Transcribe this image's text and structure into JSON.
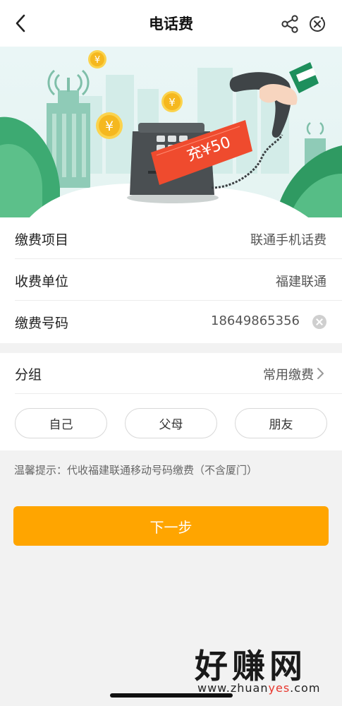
{
  "nav": {
    "title": "电话费"
  },
  "banner": {
    "coupon_text": "充¥50"
  },
  "bill": {
    "rows": [
      {
        "label": "缴费项目",
        "value": "联通手机话费"
      },
      {
        "label": "收费单位",
        "value": "福建联通"
      },
      {
        "label": "缴费号码",
        "value": "18649865356"
      }
    ]
  },
  "group": {
    "label": "分组",
    "value": "常用缴费",
    "chips": [
      "自己",
      "父母",
      "朋友"
    ]
  },
  "tip": "温馨提示：代收福建联通移动号码缴费（不含厦门）",
  "next_button": "下一步",
  "watermark": {
    "big": "好赚网",
    "small_pre": "www.zhuan",
    "small_accent": "yes",
    "small_post": ".com"
  },
  "colors": {
    "accent": "#ffa500",
    "watermark_accent": "#e8362d"
  },
  "icons": [
    "back-icon",
    "share-icon",
    "close-icon",
    "clear-icon",
    "chevron-right-icon"
  ]
}
